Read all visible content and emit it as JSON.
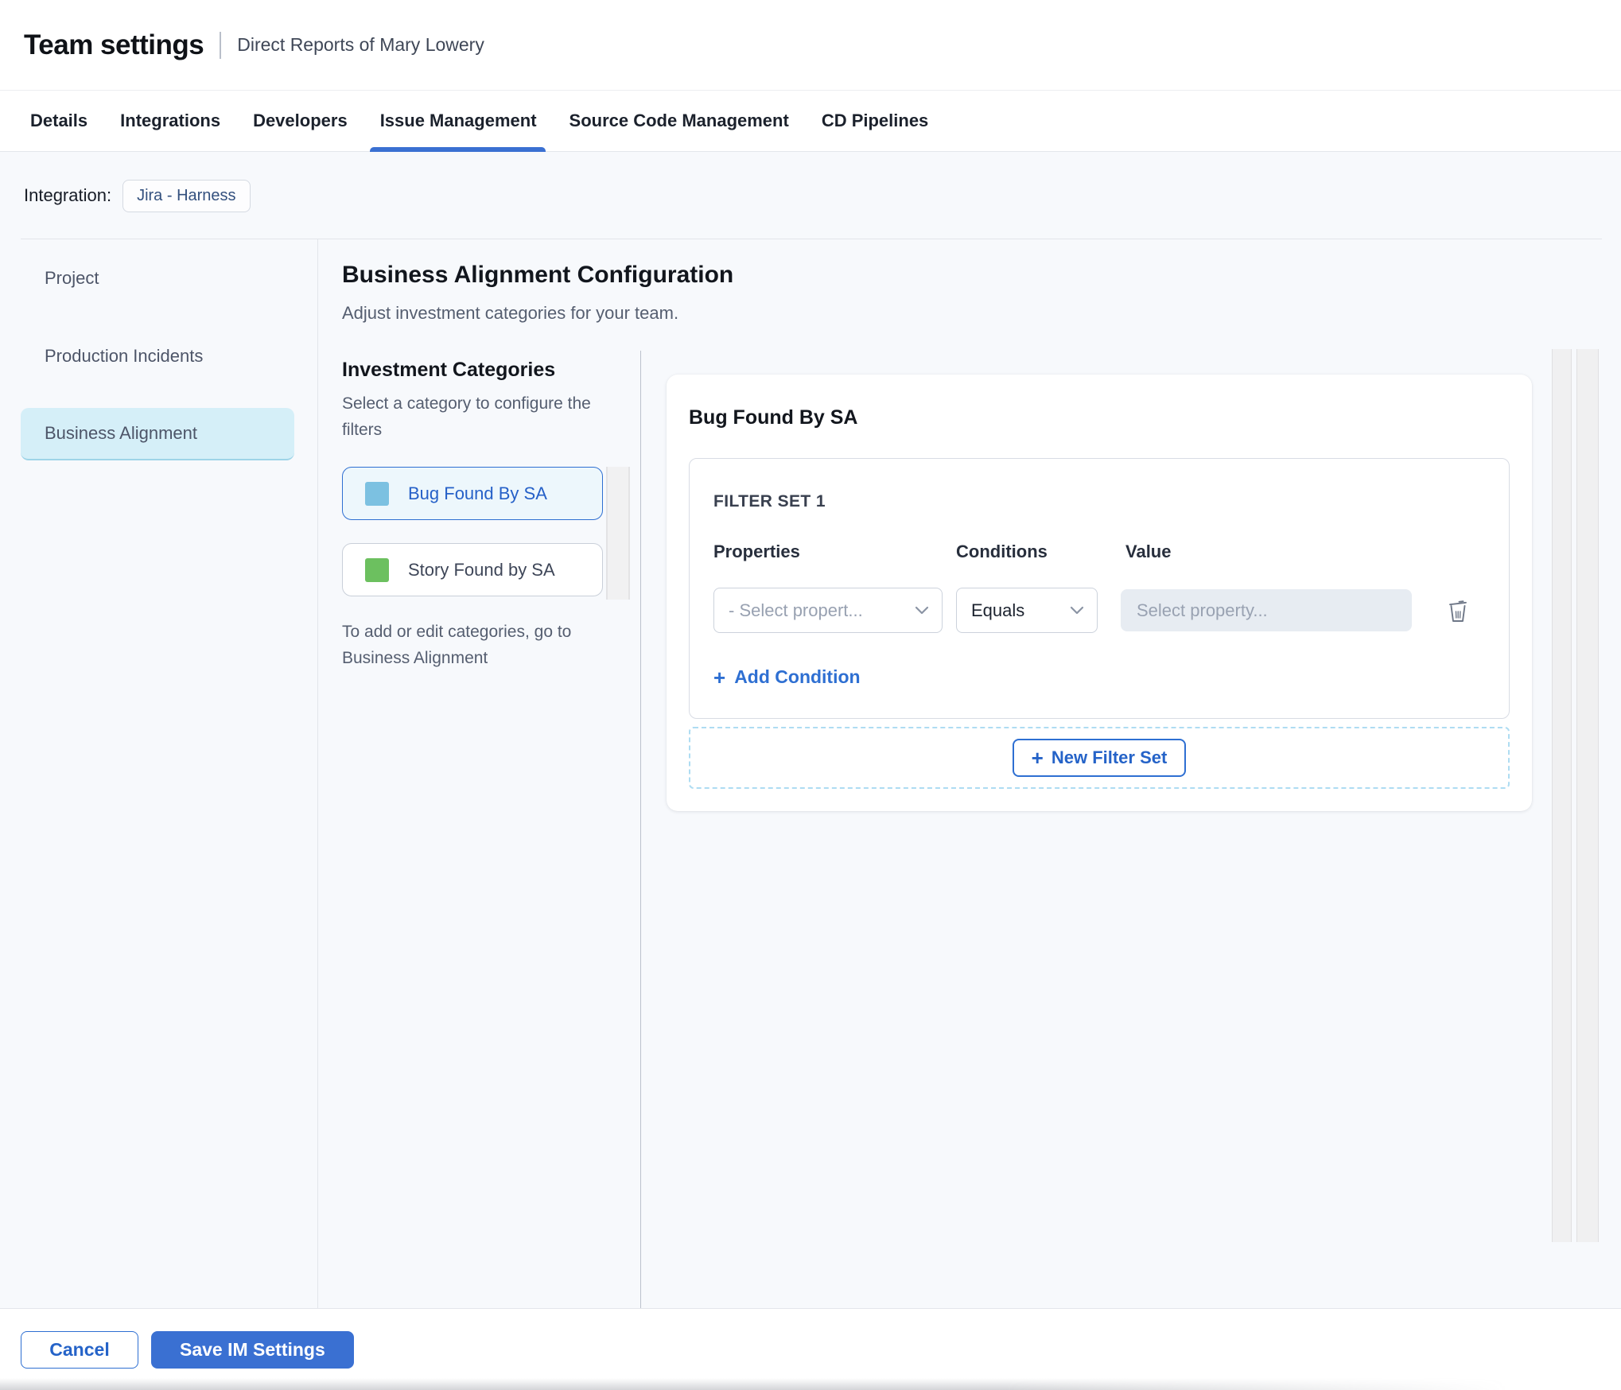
{
  "header": {
    "title": "Team settings",
    "subtitle": "Direct Reports of Mary Lowery"
  },
  "tabs": [
    {
      "label": "Details",
      "active": false
    },
    {
      "label": "Integrations",
      "active": false
    },
    {
      "label": "Developers",
      "active": false
    },
    {
      "label": "Issue Management",
      "active": true
    },
    {
      "label": "Source Code Management",
      "active": false
    },
    {
      "label": "CD Pipelines",
      "active": false
    }
  ],
  "integration": {
    "label": "Integration:",
    "chip": "Jira - Harness"
  },
  "sidebar": {
    "items": [
      {
        "label": "Project",
        "selected": false
      },
      {
        "label": "Production Incidents",
        "selected": false
      },
      {
        "label": "Business Alignment",
        "selected": true
      }
    ]
  },
  "main": {
    "title": "Business Alignment Configuration",
    "subtitle": "Adjust investment categories for your team.",
    "categories": {
      "heading": "Investment Categories",
      "hint": "Select a category to configure the filters",
      "items": [
        {
          "label": "Bug Found By SA",
          "swatch_color": "#7cc1e1",
          "selected": true
        },
        {
          "label": "Story Found by SA",
          "swatch_color": "#6cc05f",
          "selected": false
        }
      ],
      "footnote": "To add or edit categories, go to Business Alignment"
    },
    "panel": {
      "title": "Bug Found By SA",
      "filter_set": {
        "title": "FILTER SET 1",
        "columns": {
          "properties": "Properties",
          "conditions": "Conditions",
          "value": "Value"
        },
        "row": {
          "property_placeholder": "- Select propert...",
          "condition_value": "Equals",
          "value_placeholder": "Select property..."
        },
        "add_condition_label": "Add Condition"
      },
      "new_filter_set_label": "New Filter Set"
    }
  },
  "footer": {
    "cancel_label": "Cancel",
    "save_label": "Save IM Settings"
  },
  "icons": {
    "plus": "+"
  },
  "colors": {
    "accent_blue": "#3a70d2",
    "link_blue": "#2563c8",
    "chip_text": "#33507e",
    "sidebar_selected_bg": "#d5eff8",
    "category_selected_bg": "#edf7fc",
    "category_selected_border": "#2e6fd2",
    "swatch_blue": "#7cc1e1",
    "swatch_green": "#6cc05f",
    "content_bg": "#f7f9fc",
    "dashed_border": "#aedcf2",
    "disabled_input_bg": "#e7ecf2"
  }
}
